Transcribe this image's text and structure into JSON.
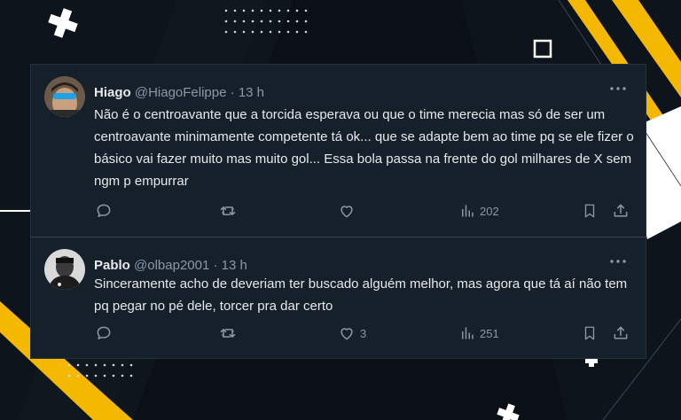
{
  "colors": {
    "background": "#0a1016",
    "card": "#15202b",
    "divider": "#38444d",
    "text_primary": "#e7e9ea",
    "text_secondary": "#8b98a5",
    "accent_yellow": "#f5b800"
  },
  "tweets": [
    {
      "name": "Hiago",
      "handle": "@HiagoFelippe",
      "dot": "·",
      "time": "13 h",
      "text": "Não é o centroavante que a torcida esperava ou que o time merecia mas só de ser um centroavante minimamente competente tá ok...  que se adapte bem ao time pq se ele fizer o básico vai fazer muito mas muito gol... Essa bola passa na frente do gol milhares de X sem ngm p empurrar",
      "likes": "",
      "views": "202",
      "icons": [
        "reply-icon",
        "retweet-icon",
        "like-icon",
        "views-icon",
        "bookmark-icon",
        "share-icon",
        "more-icon"
      ]
    },
    {
      "name": "Pablo",
      "handle": "@olbap2001",
      "dot": "·",
      "time": "13 h",
      "text": "Sinceramente acho de deveriam ter buscado alguém melhor, mas agora que tá aí não tem pq pegar no pé dele, torcer pra dar certo",
      "likes": "3",
      "views": "251",
      "icons": [
        "reply-icon",
        "retweet-icon",
        "like-icon",
        "views-icon",
        "bookmark-icon",
        "share-icon",
        "more-icon"
      ]
    }
  ]
}
